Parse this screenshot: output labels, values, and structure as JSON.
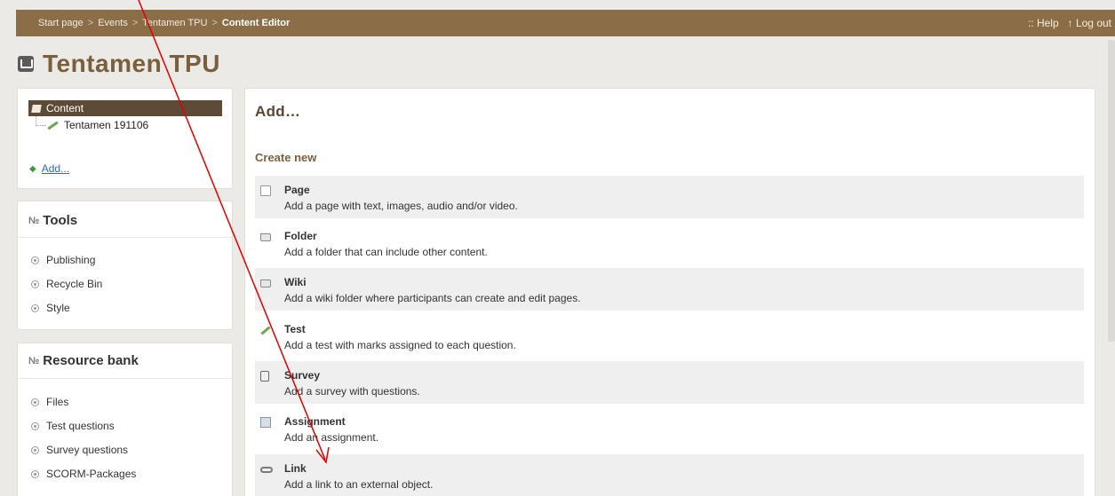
{
  "breadcrumb": {
    "items": [
      "Start page",
      "Events",
      "Tentamen TPU"
    ],
    "separator": ">",
    "current": "Content Editor"
  },
  "top_links": {
    "help": ":: Help",
    "logout": "↑ Log out"
  },
  "page": {
    "title": "Tentamen TPU"
  },
  "content_tree": {
    "root": "Content",
    "child": "Tentamen 191106",
    "add_label": "Add..."
  },
  "tools": {
    "title": "Tools",
    "items": [
      "Publishing",
      "Recycle Bin",
      "Style"
    ]
  },
  "resource_bank": {
    "title": "Resource bank",
    "items": [
      "Files",
      "Test questions",
      "Survey questions",
      "SCORM-Packages"
    ]
  },
  "main": {
    "title": "Add…",
    "section": "Create new",
    "options": [
      {
        "name": "Page",
        "desc": "Add a page with text, images, audio and/or video.",
        "icon": "page-icon"
      },
      {
        "name": "Folder",
        "desc": "Add a folder that can include other content.",
        "icon": "folder-icon"
      },
      {
        "name": "Wiki",
        "desc": "Add a wiki folder where participants can create and edit pages.",
        "icon": "folder-icon"
      },
      {
        "name": "Test",
        "desc": "Add a test with marks assigned to each question.",
        "icon": "test-icon"
      },
      {
        "name": "Survey",
        "desc": "Add a survey with questions.",
        "icon": "survey-icon"
      },
      {
        "name": "Assignment",
        "desc": "Add an assignment.",
        "icon": "assignment-icon"
      },
      {
        "name": "Link",
        "desc": "Add a link to an external object.",
        "icon": "link-icon"
      }
    ]
  },
  "colors": {
    "topbar": "#8b6d47",
    "title": "#7a5f3e",
    "annotation_arrow": "#e00000"
  }
}
